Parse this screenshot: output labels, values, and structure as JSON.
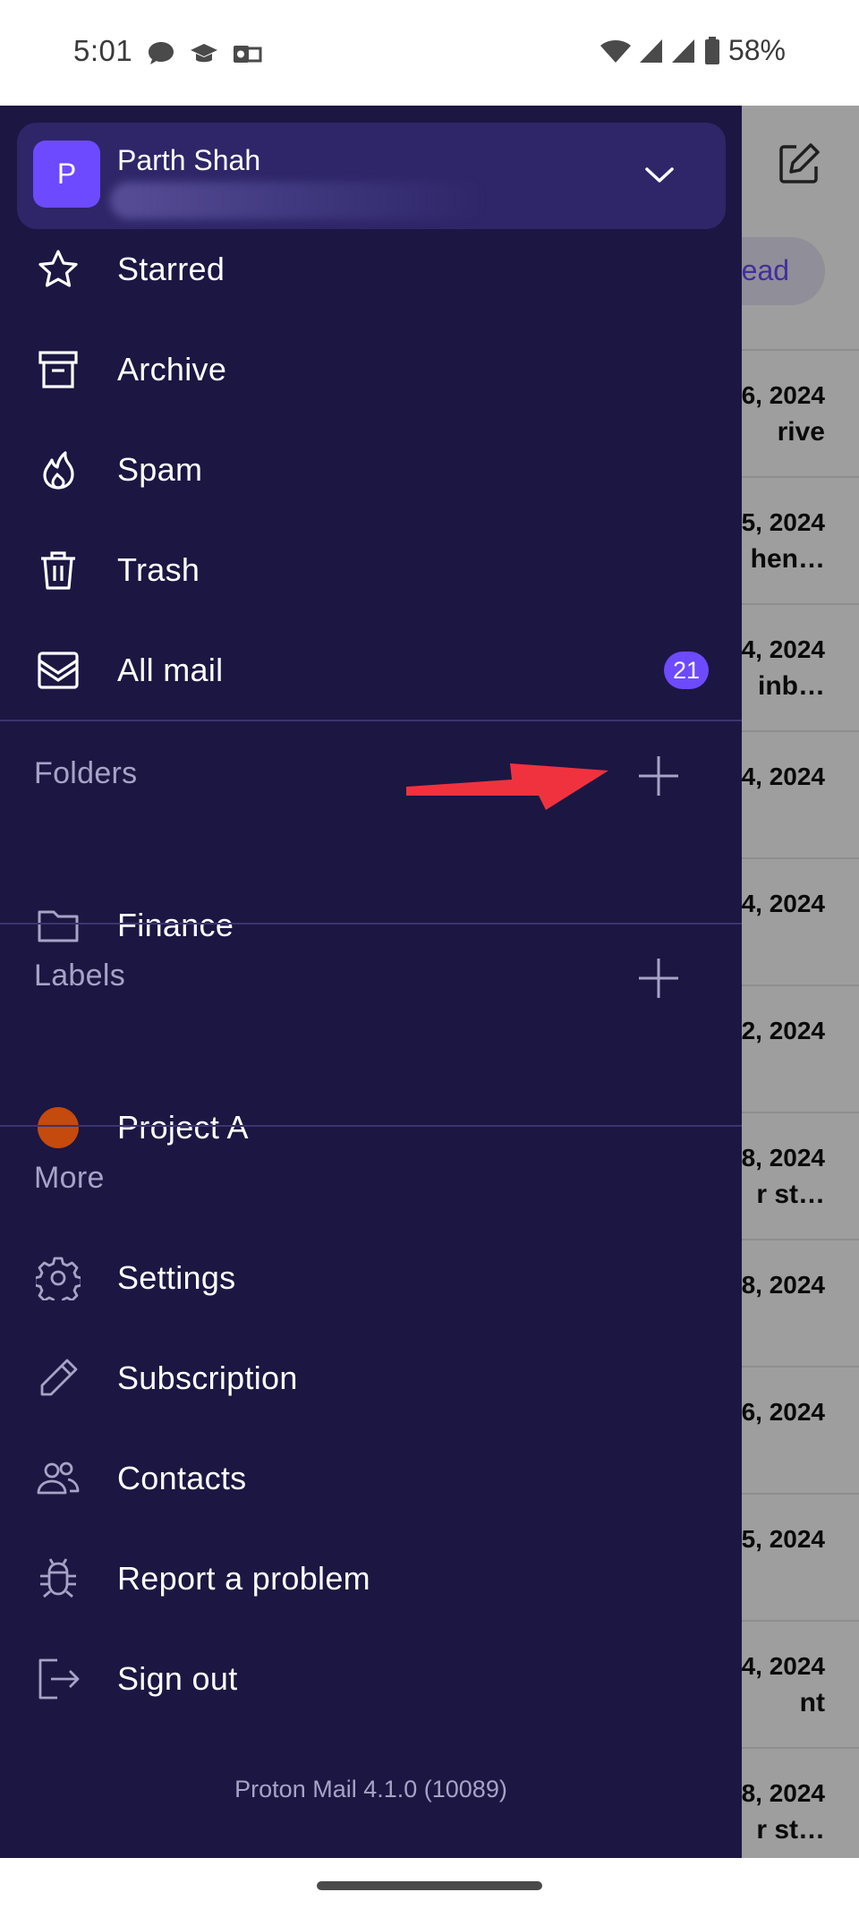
{
  "status_bar": {
    "time": "5:01",
    "battery_pct": "58%",
    "left_icons": [
      "chat-bubble-icon",
      "mortarboard-icon",
      "outlook-icon"
    ],
    "right_icons": [
      "wifi-icon",
      "signal-icon",
      "signal-icon",
      "battery-icon"
    ]
  },
  "account": {
    "avatar_letter": "P",
    "name": "Parth Shah"
  },
  "menu": {
    "starred": "Starred",
    "archive": "Archive",
    "spam": "Spam",
    "trash": "Trash",
    "all_mail": "All mail",
    "all_mail_count": "21"
  },
  "folders": {
    "title": "Folders",
    "items": [
      {
        "label": "Finance"
      }
    ]
  },
  "labels": {
    "title": "Labels",
    "items": [
      {
        "label": "Project A",
        "color": "#c44a0d"
      }
    ]
  },
  "more": {
    "title": "More",
    "settings": "Settings",
    "subscription": "Subscription",
    "contacts": "Contacts",
    "report": "Report a problem",
    "sign_out": "Sign out"
  },
  "footer": {
    "version": "Proton Mail 4.1.0 (10089)"
  },
  "background": {
    "unread_chip": "read",
    "rows": [
      {
        "date": "6, 2024",
        "subject": "rive"
      },
      {
        "date": "5, 2024",
        "subject": "hen…"
      },
      {
        "date": "4, 2024",
        "subject": "inb…"
      },
      {
        "date": "4, 2024",
        "subject": ""
      },
      {
        "date": "4, 2024",
        "subject": ""
      },
      {
        "date": "2, 2024",
        "subject": ""
      },
      {
        "date": "8, 2024",
        "subject": "r st…"
      },
      {
        "date": "8, 2024",
        "subject": ""
      },
      {
        "date": "6, 2024",
        "subject": ""
      },
      {
        "date": "5, 2024",
        "subject": ""
      },
      {
        "date": "4, 2024",
        "subject": "nt"
      },
      {
        "date": "8, 2024",
        "subject": "r st…"
      }
    ]
  },
  "colors": {
    "drawer_bg": "#1c1642",
    "accent": "#6d4aff",
    "annotation_arrow": "#f0323e"
  }
}
